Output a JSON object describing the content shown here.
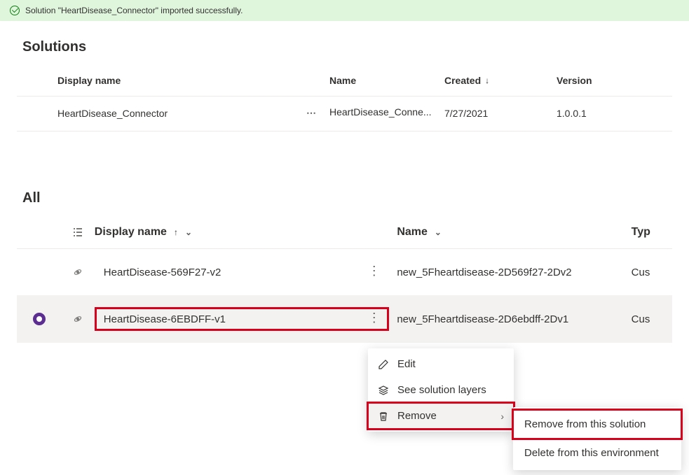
{
  "notification": {
    "message": "Solution \"HeartDisease_Connector\" imported successfully."
  },
  "solutions": {
    "heading": "Solutions",
    "columns": {
      "display_name": "Display name",
      "name": "Name",
      "created": "Created",
      "version": "Version"
    },
    "row": {
      "display_name": "HeartDisease_Connector",
      "name": "HeartDisease_Conne...",
      "created": "7/27/2021",
      "version": "1.0.0.1"
    }
  },
  "components": {
    "heading": "All",
    "columns": {
      "display_name": "Display name",
      "name": "Name",
      "type": "Typ"
    },
    "rows": [
      {
        "display_name": "HeartDisease-569F27-v2",
        "name": "new_5Fheartdisease-2D569f27-2Dv2",
        "type": "Cus"
      },
      {
        "display_name": "HeartDisease-6EBDFF-v1",
        "name": "new_5Fheartdisease-2D6ebdff-2Dv1",
        "type": "Cus"
      }
    ]
  },
  "context_menu": {
    "edit": "Edit",
    "layers": "See solution layers",
    "remove": "Remove"
  },
  "submenu": {
    "remove_solution": "Remove from this solution",
    "delete_env": "Delete from this environment"
  }
}
